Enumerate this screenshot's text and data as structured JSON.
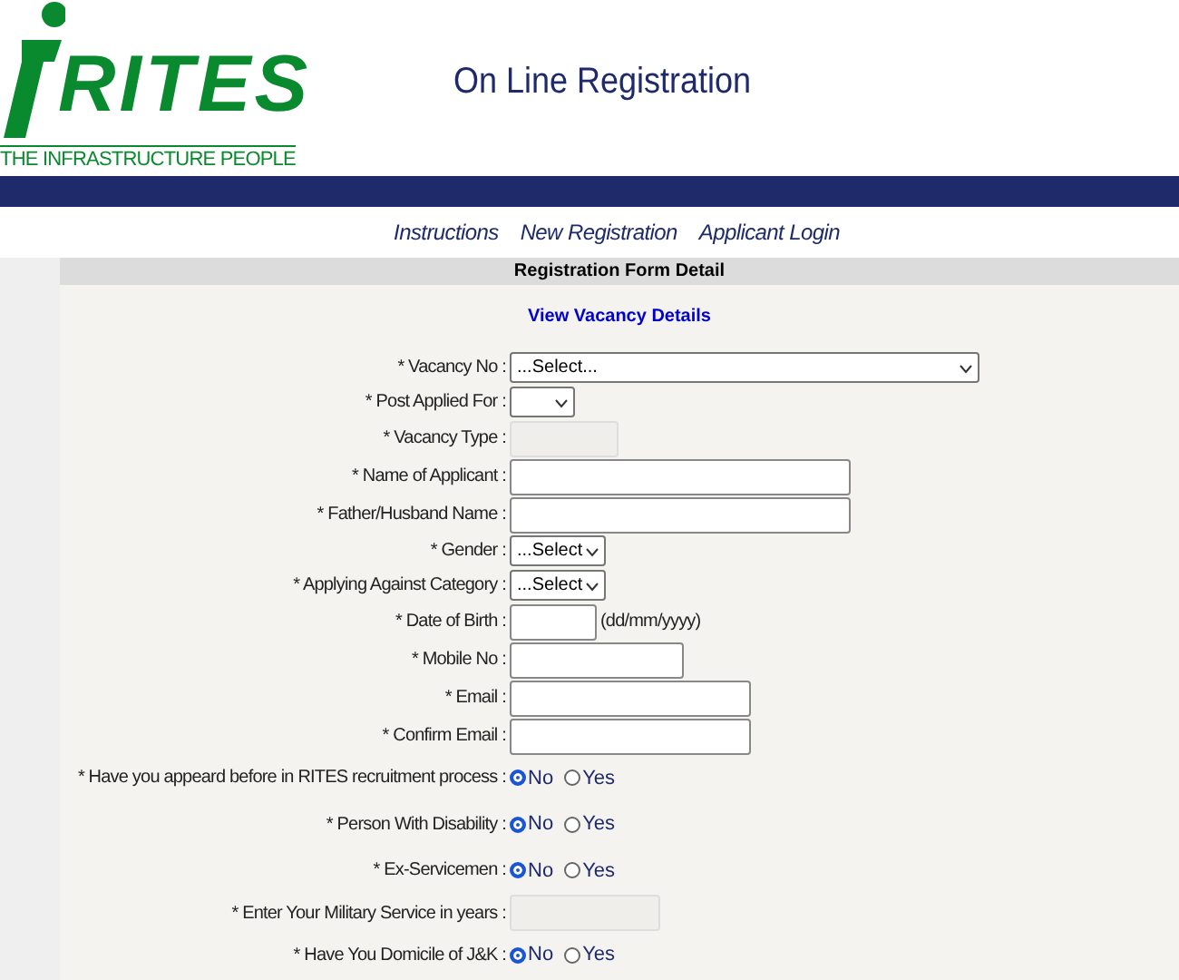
{
  "logo": {
    "name": "RITES",
    "tagline": "THE INFRASTRUCTURE PEOPLE"
  },
  "title": "On Line Registration",
  "nav": [
    {
      "label": "Instructions"
    },
    {
      "label": "New Registration"
    },
    {
      "label": "Applicant Login"
    }
  ],
  "form": {
    "heading": "Registration Form Detail",
    "link": "View Vacancy Details",
    "rows": [
      {
        "kind": "select",
        "label": "* Vacancy No :",
        "value": "...Select..."
      },
      {
        "kind": "select",
        "label": "* Post Applied For :"
      },
      {
        "kind": "text",
        "label": "* Vacancy Type :",
        "disabled": true
      },
      {
        "kind": "text",
        "label": "* Name of Applicant :",
        "disabled": false
      },
      {
        "kind": "text",
        "label": "* Father/Husband Name :",
        "disabled": false
      },
      {
        "kind": "select",
        "label": "* Gender :",
        "value": "...Select"
      },
      {
        "kind": "select",
        "label": "* Applying Against Category :",
        "value": "...Select"
      },
      {
        "kind": "text",
        "label": "* Date of Birth :",
        "disabled": false,
        "hint": "(dd/mm/yyyy)"
      },
      {
        "kind": "text",
        "label": "* Mobile No :",
        "disabled": false
      },
      {
        "kind": "text",
        "label": "* Email :",
        "disabled": false
      },
      {
        "kind": "text",
        "label": "* Confirm Email :",
        "disabled": false
      },
      {
        "kind": "radio",
        "label": "* Have you appeard before in RITES recruitment process :",
        "options": [
          {
            "label": "No",
            "selected": true
          },
          {
            "label": "Yes",
            "selected": false
          }
        ]
      },
      {
        "kind": "radio",
        "label": "* Person With Disability :",
        "options": [
          {
            "label": "No",
            "selected": true
          },
          {
            "label": "Yes",
            "selected": false
          }
        ]
      },
      {
        "kind": "radio",
        "label": "* Ex-Servicemen :",
        "options": [
          {
            "label": "No",
            "selected": true
          },
          {
            "label": "Yes",
            "selected": false
          }
        ]
      },
      {
        "kind": "text",
        "label": "* Enter Your Military Service in years :",
        "disabled": true
      },
      {
        "kind": "radio",
        "label": "* Have You Domicile of J&K :",
        "options": [
          {
            "label": "No",
            "selected": true
          },
          {
            "label": "Yes",
            "selected": false
          }
        ]
      }
    ]
  }
}
